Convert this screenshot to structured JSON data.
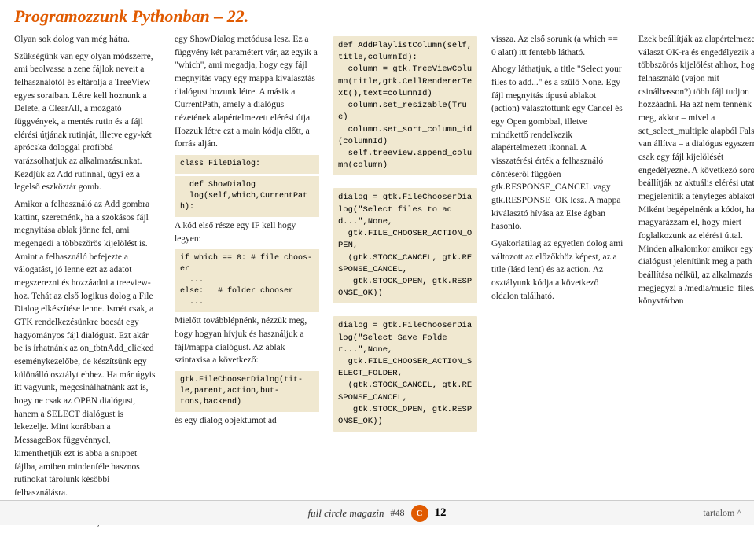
{
  "header": {
    "title": "Programozzunk Pythonban – 22."
  },
  "footer": {
    "magazine": "full circle magazin",
    "issue": "#48",
    "page": "12",
    "toc": "tartalom ^"
  },
  "col1": {
    "paragraphs": [
      "Olyan sok dolog van még hátra.",
      "Szükségünk van egy olyan módszerre, ami beolvassa a zene fájlok neveit a felhasználótól és eltárolja a TreeView egyes soraiban. Létre kell hoznunk a Delete, a ClearAll, a mozgató függvények, a mentés rutin és a fájl elérési útjának rutinját, illetve egy-két aprócska dologgal profibbá varázsolhatjuk az alkalmazásunkat. Kezdjük az Add rutinnal, úgyi ez a legelső eszköztár gomb.",
      "Amikor a felhasználó az Add gombra kattint, szeretnénk, ha a szokásos fájl megnyitása ablak jönne fel, ami megengedi a többszörös kijelölést is. Amint a felhasználó befejezte a válogatást, jó lenne ezt az adatot megszerezni és hozzáadni a treeview-hoz. Tehát az első logikus dolog a File Dialog elkészítése lenne. Ismét csak, a GTK rendelkezésünkre bocsát egy hagyományos fájl dialógust. Ezt akár be is írhatnánk az on_tbtnAdd_clicked eseménykezelőbe, de készítsünk egy különálló osztályt ehhez. Ha már úgyis itt vagyunk, megcsinálhatnánk azt is, hogy ne csak az OPEN dialógust, hanem a SELECT dialógust is lekezelje. Mint korábban a MessageBox függvénnyel, kimenthetjük ezt is abba a snippet fájlba, amiben mindenféle hasznos rutinokat tárolunk későbbi felhasználásra.",
      "Egy új, FileDialog nevű osztály definiálásával kezdünk, aminek csak"
    ]
  },
  "col2": {
    "intro": "egy ShowDialog metódusa lesz. Ez a függvény két paramétert vár, az egyik a \"which\", ami megadja, hogy egy fájl megnyitás vagy egy mappa kiválasztás dialógust hozunk létre. A másik a CurrentPath, amely a dialógus nézetének alapértelmezett elérési útja. Hozzuk létre ezt a main kódja előtt, a forrás alján.",
    "class_label": "class FileDialog:",
    "def_label": "  def ShowDialog\n  log(self,which,CurrentPath):",
    "code_intro": "A kód első része egy IF kell hogy legyen:",
    "if_code": "if which == 0: # file choos-\ner\n  ...\nelse:   # folder chooser\n  ...",
    "before_code": "Mielőtt továbblépnénk, nézzük meg, hogy hogyan hívjuk és használjuk a fájl/mappa dialógust. Az ablak szintaxisa a következő:",
    "syntax_code": "gtk.FileChooserDialog(tit-\nle,parent,action,but-\ntons,backend)",
    "after_code": "és egy dialog objektumot ad"
  },
  "col3": {
    "code1": "def AddPlaylistColumn(self,title,columnId):\n  column = gtk.TreeViewColumn(title,gtk.CellRendererText(),text=columnId)\n  column.set_resizable(True)\n  column.set_sort_column_id(columnId)\n  self.treeview.append_column(column)",
    "code2": "dialog = gtk.FileChooserDialog(\"Select files to add...\",None,\n  gtk.FILE_CHOOSER_ACTION_OPEN,\n  (gtk.STOCK_CANCEL, gtk.RESPONSE_CANCEL,\n   gtk.STOCK_OPEN, gtk.RESPONSE_OK))",
    "code3": "dialog = gtk.FileChooserDialog(\"Select Save Folder...\",None,\n  gtk.FILE_CHOOSER_ACTION_SELECT_FOLDER,\n  (gtk.STOCK_CANCEL, gtk.RESPONSE_CANCEL,\n   gtk.STOCK_OPEN, gtk.RESPONSE_OK))"
  },
  "col4": {
    "paragraphs": [
      "vissza. Az első sorunk (a which == 0 alatt) itt fentebb látható.",
      "Ahogy láthatjuk, a title \"Select your files to add...\" és a szülő None. Egy fájl megnyitás típusú ablakot (action) választottunk egy Cancel és egy Open gombbal, illetve mindkettő rendelkezik alapértelmezett ikonnal. A visszatérési érték a felhasználó döntéséről függően gtk.RESPONSE_CANCEL vagy gtk.RESPONSE_OK lesz. A mappa kiválasztó hívása az Else ágban hasonló.",
      "Gyakorlatilag az egyetlen dolog ami változott az előzőkhöz képest, az a title (lásd lent) és az action. Az osztályunk kódja a következő oldalon található."
    ]
  },
  "col5": {
    "paragraphs": [
      "Ezek beállítják az alapértelmezett választ OK-ra és engedélyezik a többszörös kijelölést ahhoz, hogy a felhasználó (vajon mit csinálhasson?) több fájl tudjon hozzáadni. Ha azt nem tennénk meg, akkor – mivel a set_select_multiple alapból False-ra van állítva – a dialógus egyszerre csak egy fájl kijelölését engedélyezné. A következő sorok beállítják az aktuális elérési utat és megjelenítik a tényleges ablakot. Miként begépelnénk a kódot, hadd magyarázzam el, hogy miért foglalkozunk az elérési úttal. Minden alkalomkor amikor egy dialógust jelenítünk meg a path beállítása nélkül, az alkalmazás megjegyzi a /media/music_files/ könyvtárban"
    ]
  }
}
